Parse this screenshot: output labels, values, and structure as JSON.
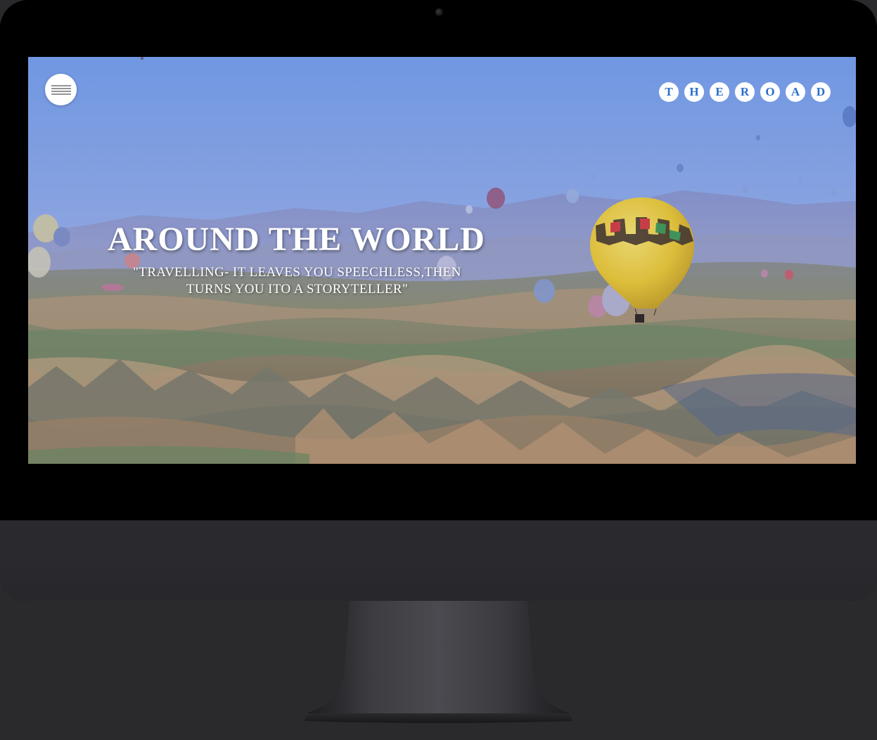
{
  "header": {
    "menu_icon": "hamburger-icon",
    "brand_letters": [
      "T",
      "H",
      "E",
      "R",
      "O",
      "A",
      "D"
    ]
  },
  "hero": {
    "title": "AROUND THE WORLD",
    "quote_line1": "\"TRAVELLING- IT LEAVES YOU SPEECHLESS,THEN",
    "quote_line2": "TURNS YOU ITO A STORYTELLER\"",
    "background_image": "hot-air-balloons-over-valley"
  },
  "colors": {
    "brand_text": "#2a6fc9",
    "sky_top": "#7aa3ea",
    "balloon_yellow": "#f3d236",
    "device_body": "#2a2a2d"
  }
}
